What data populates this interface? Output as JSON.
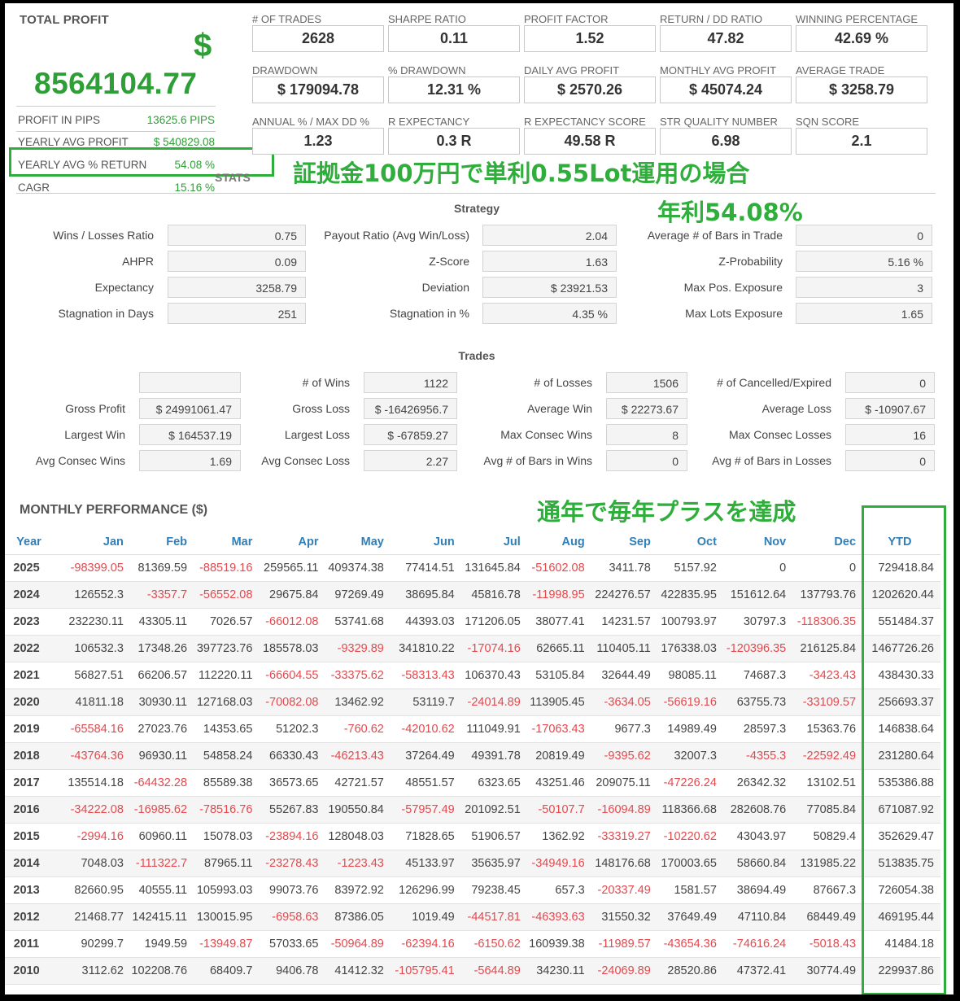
{
  "summary": {
    "total_profit_label": "TOTAL PROFIT",
    "dollar_sign": "$",
    "total_profit_value": "8564104.77",
    "rows": [
      {
        "label": "PROFIT IN PIPS",
        "value": "13625.6 PIPS"
      },
      {
        "label": "YEARLY AVG PROFIT",
        "value": "$ 540829.08"
      },
      {
        "label": "YEARLY AVG % RETURN",
        "value": "54.08 %"
      },
      {
        "label": "CAGR",
        "value": "15.16 %"
      }
    ]
  },
  "metrics": [
    {
      "label": "# OF TRADES",
      "value": "2628"
    },
    {
      "label": "SHARPE RATIO",
      "value": "0.11"
    },
    {
      "label": "PROFIT FACTOR",
      "value": "1.52"
    },
    {
      "label": "RETURN / DD RATIO",
      "value": "47.82"
    },
    {
      "label": "WINNING PERCENTAGE",
      "value": "42.69 %"
    },
    {
      "label": "DRAWDOWN",
      "value": "$ 179094.78"
    },
    {
      "label": "% DRAWDOWN",
      "value": "12.31 %"
    },
    {
      "label": "DAILY AVG PROFIT",
      "value": "$ 2570.26"
    },
    {
      "label": "MONTHLY AVG PROFIT",
      "value": "$ 45074.24"
    },
    {
      "label": "AVERAGE TRADE",
      "value": "$ 3258.79"
    },
    {
      "label": "ANNUAL % / MAX DD %",
      "value": "1.23"
    },
    {
      "label": "R EXPECTANCY",
      "value": "0.3 R"
    },
    {
      "label": "R EXPECTANCY SCORE",
      "value": "49.58 R"
    },
    {
      "label": "STR QUALITY NUMBER",
      "value": "6.98"
    },
    {
      "label": "SQN SCORE",
      "value": "2.1"
    }
  ],
  "annotations": {
    "line1": "証拠金100万円で単利0.55Lot運用の場合",
    "line2": "年利54.08%",
    "line3": "通年で毎年プラスを達成",
    "stats_heading": "STATS"
  },
  "strategy": {
    "title": "Strategy",
    "rows": [
      [
        {
          "label": "Wins / Losses Ratio",
          "value": "0.75"
        },
        {
          "label": "Payout Ratio (Avg Win/Loss)",
          "value": "2.04"
        },
        {
          "label": "Average # of Bars in Trade",
          "value": "0"
        }
      ],
      [
        {
          "label": "AHPR",
          "value": "0.09"
        },
        {
          "label": "Z-Score",
          "value": "1.63"
        },
        {
          "label": "Z-Probability",
          "value": "5.16 %"
        }
      ],
      [
        {
          "label": "Expectancy",
          "value": "3258.79"
        },
        {
          "label": "Deviation",
          "value": "$ 23921.53"
        },
        {
          "label": "Max Pos. Exposure",
          "value": "3"
        }
      ],
      [
        {
          "label": "Stagnation in Days",
          "value": "251"
        },
        {
          "label": "Stagnation in %",
          "value": "4.35 %"
        },
        {
          "label": "Max Lots Exposure",
          "value": "1.65"
        }
      ]
    ]
  },
  "trades": {
    "title": "Trades",
    "rows": [
      [
        {
          "label": "",
          "value": ""
        },
        {
          "label": "# of Wins",
          "value": "1122"
        },
        {
          "label": "# of Losses",
          "value": "1506"
        },
        {
          "label": "# of Cancelled/Expired",
          "value": "0"
        }
      ],
      [
        {
          "label": "Gross Profit",
          "value": "$ 24991061.47"
        },
        {
          "label": "Gross Loss",
          "value": "$ -16426956.7"
        },
        {
          "label": "Average Win",
          "value": "$ 22273.67"
        },
        {
          "label": "Average Loss",
          "value": "$ -10907.67"
        }
      ],
      [
        {
          "label": "Largest Win",
          "value": "$ 164537.19"
        },
        {
          "label": "Largest Loss",
          "value": "$ -67859.27"
        },
        {
          "label": "Max Consec Wins",
          "value": "8"
        },
        {
          "label": "Max Consec Losses",
          "value": "16"
        }
      ],
      [
        {
          "label": "Avg Consec Wins",
          "value": "1.69"
        },
        {
          "label": "Avg Consec Loss",
          "value": "2.27"
        },
        {
          "label": "Avg # of Bars in Wins",
          "value": "0"
        },
        {
          "label": "Avg # of Bars in Losses",
          "value": "0"
        }
      ]
    ]
  },
  "monthly": {
    "title": "MONTHLY PERFORMANCE ($)",
    "headers": [
      "Year",
      "Jan",
      "Feb",
      "Mar",
      "Apr",
      "May",
      "Jun",
      "Jul",
      "Aug",
      "Sep",
      "Oct",
      "Nov",
      "Dec",
      "YTD"
    ],
    "rows": [
      [
        "2025",
        "-98399.05",
        "81369.59",
        "-88519.16",
        "259565.11",
        "409374.38",
        "77414.51",
        "131645.84",
        "-51602.08",
        "3411.78",
        "5157.92",
        "0",
        "0",
        "729418.84"
      ],
      [
        "2024",
        "126552.3",
        "-3357.7",
        "-56552.08",
        "29675.84",
        "97269.49",
        "38695.84",
        "45816.78",
        "-11998.95",
        "224276.57",
        "422835.95",
        "151612.64",
        "137793.76",
        "1202620.44"
      ],
      [
        "2023",
        "232230.11",
        "43305.11",
        "7026.57",
        "-66012.08",
        "53741.68",
        "44393.03",
        "171206.05",
        "38077.41",
        "14231.57",
        "100793.97",
        "30797.3",
        "-118306.35",
        "551484.37"
      ],
      [
        "2022",
        "106532.3",
        "17348.26",
        "397723.76",
        "185578.03",
        "-9329.89",
        "341810.22",
        "-17074.16",
        "62665.11",
        "110405.11",
        "176338.03",
        "-120396.35",
        "216125.84",
        "1467726.26"
      ],
      [
        "2021",
        "56827.51",
        "66206.57",
        "112220.11",
        "-66604.55",
        "-33375.62",
        "-58313.43",
        "106370.43",
        "53105.84",
        "32644.49",
        "98085.11",
        "74687.3",
        "-3423.43",
        "438430.33"
      ],
      [
        "2020",
        "41811.18",
        "30930.11",
        "127168.03",
        "-70082.08",
        "13462.92",
        "53119.7",
        "-24014.89",
        "113905.45",
        "-3634.05",
        "-56619.16",
        "63755.73",
        "-33109.57",
        "256693.37"
      ],
      [
        "2019",
        "-65584.16",
        "27023.76",
        "14353.65",
        "51202.3",
        "-760.62",
        "-42010.62",
        "111049.91",
        "-17063.43",
        "9677.3",
        "14989.49",
        "28597.3",
        "15363.76",
        "146838.64"
      ],
      [
        "2018",
        "-43764.36",
        "96930.11",
        "54858.24",
        "66330.43",
        "-46213.43",
        "37264.49",
        "49391.78",
        "20819.49",
        "-9395.62",
        "32007.3",
        "-4355.3",
        "-22592.49",
        "231280.64"
      ],
      [
        "2017",
        "135514.18",
        "-64432.28",
        "85589.38",
        "36573.65",
        "42721.57",
        "48551.57",
        "6323.65",
        "43251.46",
        "209075.11",
        "-47226.24",
        "26342.32",
        "13102.51",
        "535386.88"
      ],
      [
        "2016",
        "-34222.08",
        "-16985.62",
        "-78516.76",
        "55267.83",
        "190550.84",
        "-57957.49",
        "201092.51",
        "-50107.7",
        "-16094.89",
        "118366.68",
        "282608.76",
        "77085.84",
        "671087.92"
      ],
      [
        "2015",
        "-2994.16",
        "60960.11",
        "15078.03",
        "-23894.16",
        "128048.03",
        "71828.65",
        "51906.57",
        "1362.92",
        "-33319.27",
        "-10220.62",
        "43043.97",
        "50829.4",
        "352629.47"
      ],
      [
        "2014",
        "7048.03",
        "-111322.7",
        "87965.11",
        "-23278.43",
        "-1223.43",
        "45133.97",
        "35635.97",
        "-34949.16",
        "148176.68",
        "170003.65",
        "58660.84",
        "131985.22",
        "513835.75"
      ],
      [
        "2013",
        "82660.95",
        "40555.11",
        "105993.03",
        "99073.76",
        "83972.92",
        "126296.99",
        "79238.45",
        "657.3",
        "-20337.49",
        "1581.57",
        "38694.49",
        "87667.3",
        "726054.38"
      ],
      [
        "2012",
        "21468.77",
        "142415.11",
        "130015.95",
        "-6958.63",
        "87386.05",
        "1019.49",
        "-44517.81",
        "-46393.63",
        "31550.32",
        "37649.49",
        "47110.84",
        "68449.49",
        "469195.44"
      ],
      [
        "2011",
        "90299.7",
        "1949.59",
        "-13949.87",
        "57033.65",
        "-50964.89",
        "-62394.16",
        "-6150.62",
        "160939.38",
        "-11989.57",
        "-43654.36",
        "-74616.24",
        "-5018.43",
        "41484.18"
      ],
      [
        "2010",
        "3112.62",
        "102208.76",
        "68409.7",
        "9406.78",
        "41412.32",
        "-105795.41",
        "-5644.89",
        "34230.11",
        "-24069.89",
        "28520.86",
        "47372.41",
        "30774.49",
        "229937.86"
      ]
    ]
  },
  "colors": {
    "profit_green": "#2e9e36",
    "annotation_green": "#2fae3b",
    "negative_red": "#e5484d",
    "header_blue": "#2f7fb8"
  }
}
